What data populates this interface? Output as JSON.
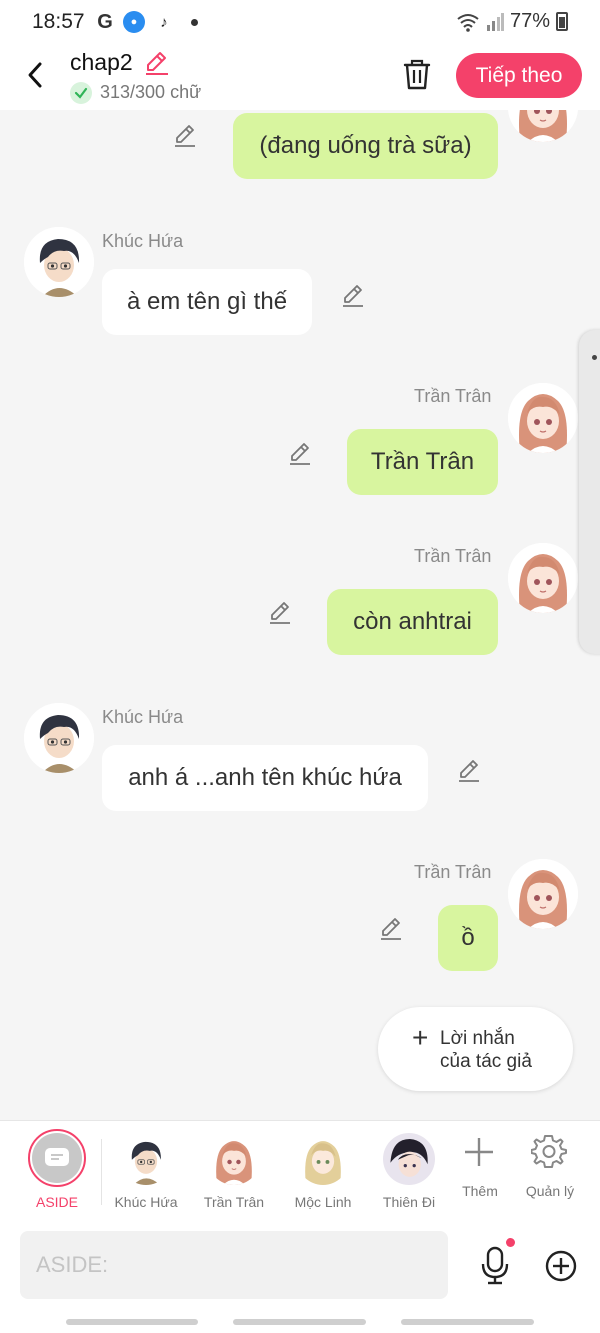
{
  "status_bar": {
    "time": "18:57",
    "g_label": "G",
    "tiktok_glyph": "♪",
    "battery": "77%"
  },
  "header": {
    "title": "chap2",
    "word_count": "313/300 chữ",
    "next_label": "Tiếp theo"
  },
  "messages": [
    {
      "sender": "Trần Trân",
      "text": "(đang uống trà sữa)",
      "side": "right",
      "show_name": false
    },
    {
      "sender": "Khúc Hứa",
      "text": "à em tên gì thế",
      "side": "left",
      "show_name": true
    },
    {
      "sender": "Trần Trân",
      "text": "Trần Trân",
      "side": "right",
      "show_name": true
    },
    {
      "sender": "Trần Trân",
      "text": "còn anhtrai",
      "side": "right",
      "show_name": true
    },
    {
      "sender": "Khúc Hứa",
      "text": "anh á ...anh tên khúc hứa",
      "side": "left",
      "show_name": true
    },
    {
      "sender": "Trần Trân",
      "text": "ồ",
      "side": "right",
      "show_name": true
    }
  ],
  "author_note": {
    "line1": "Lời nhắn",
    "line2": "của tác giả"
  },
  "character_bar": {
    "aside_label": "ASIDE",
    "characters": [
      "Khúc Hứa",
      "Trần Trân",
      "Mộc Linh",
      "Thiên Đi"
    ],
    "add_label": "Thêm",
    "manage_label": "Quản lý"
  },
  "input": {
    "placeholder": "ASIDE:"
  },
  "colors": {
    "accent": "#f4416a",
    "bubble_green": "#d8f59f",
    "background": "#f5f5f5"
  },
  "icons": [
    "back-icon",
    "edit-icon",
    "check-icon",
    "trash-icon",
    "pencil-icon",
    "plus-icon",
    "gear-icon",
    "mic-icon",
    "add-circle-icon"
  ]
}
